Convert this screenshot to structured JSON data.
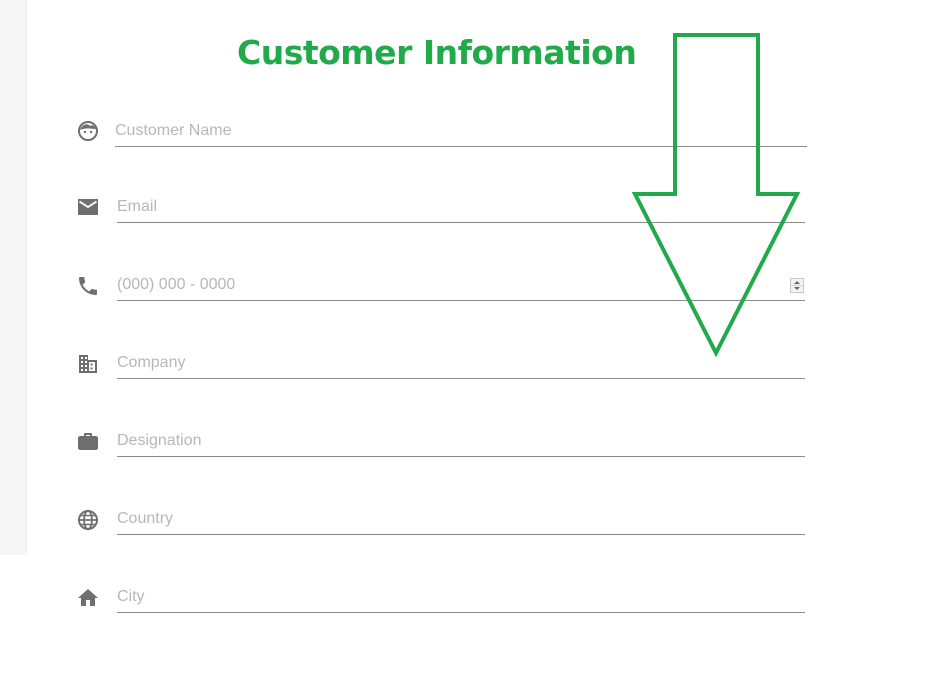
{
  "page": {
    "title": "Customer Information"
  },
  "colors": {
    "accent": "#22aa4a",
    "icon": "#6f6f6f",
    "underline": "#8a8a8a",
    "placeholder": "#b7b7b7"
  },
  "form": {
    "fields": [
      {
        "id": "customer-name",
        "icon": "face-icon",
        "placeholder": "Customer Name",
        "value": ""
      },
      {
        "id": "email",
        "icon": "mail-icon",
        "placeholder": "Email",
        "value": ""
      },
      {
        "id": "phone",
        "icon": "phone-icon",
        "placeholder": "(000) 000 - 0000",
        "value": ""
      },
      {
        "id": "company",
        "icon": "building-icon",
        "placeholder": "Company",
        "value": ""
      },
      {
        "id": "designation",
        "icon": "briefcase-icon",
        "placeholder": "Designation",
        "value": ""
      },
      {
        "id": "country",
        "icon": "globe-icon",
        "placeholder": "Country",
        "value": ""
      },
      {
        "id": "city",
        "icon": "home-icon",
        "placeholder": "City",
        "value": ""
      }
    ]
  },
  "annotation": {
    "shape": "down-arrow",
    "color": "#22aa4a"
  }
}
